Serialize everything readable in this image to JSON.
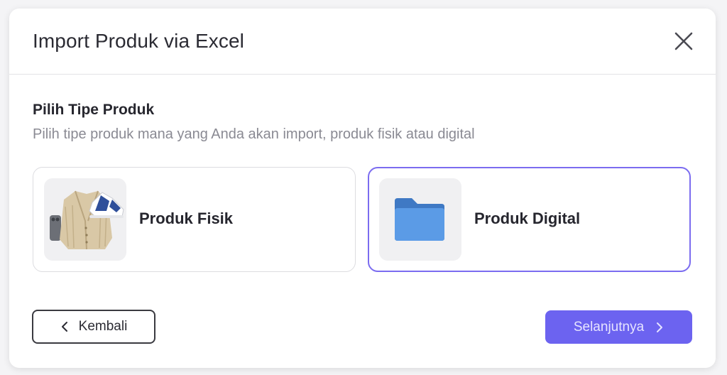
{
  "modal": {
    "title": "Import Produk via Excel",
    "close_icon": "close-icon"
  },
  "section": {
    "title": "Pilih Tipe Produk",
    "subtitle": "Pilih tipe produk mana yang Anda akan import, produk fisik atau digital"
  },
  "options": [
    {
      "label": "Produk Fisik",
      "icon": "physical-products-image",
      "selected": false
    },
    {
      "label": "Produk Digital",
      "icon": "folder-icon",
      "selected": true
    }
  ],
  "footer": {
    "back_label": "Kembali",
    "next_label": "Selanjutnya"
  },
  "colors": {
    "accent": "#6c63f0",
    "selected_border": "#7b6cf0",
    "folder": "#5b9be6"
  }
}
